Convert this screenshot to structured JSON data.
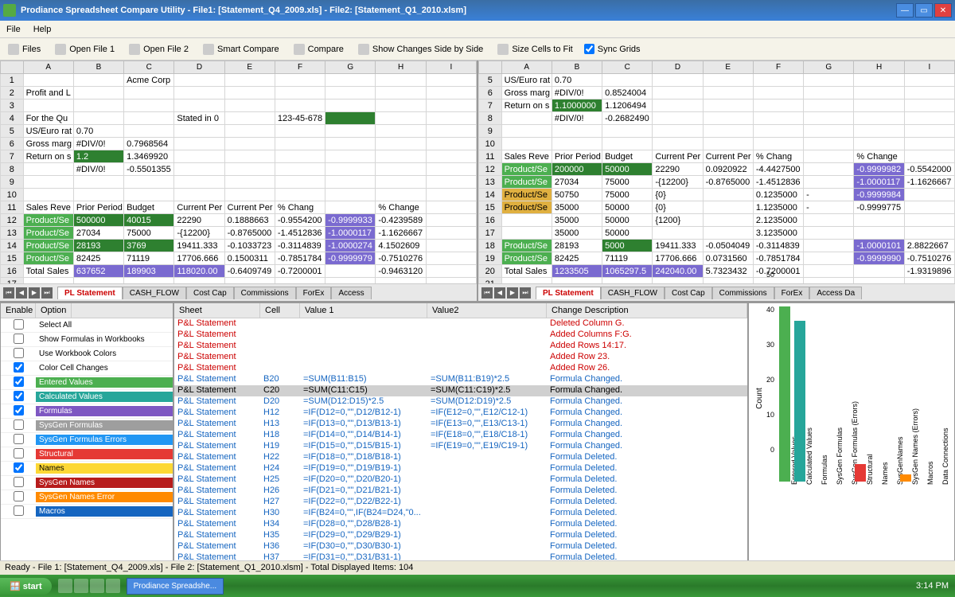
{
  "window": {
    "title": "Prodiance Spreadsheet Compare Utility - File1: [Statement_Q4_2009.xls] - File2: [Statement_Q1_2010.xlsm]"
  },
  "menu": {
    "file": "File",
    "help": "Help"
  },
  "toolbar": {
    "files": "Files",
    "open1": "Open File 1",
    "open2": "Open File 2",
    "smart": "Smart Compare",
    "compare": "Compare",
    "sidebyside": "Show Changes Side by Side",
    "sizecells": "Size Cells to Fit",
    "syncgrids": "Sync Grids"
  },
  "sheet_cols": [
    "",
    "A",
    "B",
    "C",
    "D",
    "E",
    "F",
    "G",
    "H",
    "I"
  ],
  "sheet1": [
    [
      "1",
      "",
      "",
      "Acme Corp",
      "",
      "",
      "",
      "",
      "",
      ""
    ],
    [
      "2",
      "Profit and L",
      "",
      "",
      "",
      "",
      "",
      "",
      "",
      ""
    ],
    [
      "3",
      "",
      "",
      "",
      "",
      "",
      "",
      "",
      "",
      ""
    ],
    [
      "4",
      "For the Qu",
      "",
      "",
      "Stated in 0",
      "",
      "123-45-678",
      "",
      "",
      ""
    ],
    [
      "5",
      "US/Euro rat",
      "0.70",
      "",
      "",
      "",
      "",
      "",
      "",
      ""
    ],
    [
      "6",
      "Gross marg",
      "#DIV/0!",
      "0.7968564",
      "",
      "",
      "",
      "",
      "",
      ""
    ],
    [
      "7",
      "Return on s",
      "1.2",
      "1.3469920",
      "",
      "",
      "",
      "",
      "",
      ""
    ],
    [
      "8",
      "",
      "#DIV/0!",
      "-0.5501355",
      "",
      "",
      "",
      "",
      "",
      ""
    ],
    [
      "9",
      "",
      "",
      "",
      "",
      "",
      "",
      "",
      "",
      ""
    ],
    [
      "10",
      "",
      "",
      "",
      "",
      "",
      "",
      "",
      "",
      ""
    ],
    [
      "11",
      "Sales Reve",
      "Prior Period",
      "Budget",
      "Current Per",
      "Current Per",
      "% Chang",
      "",
      "% Change",
      ""
    ],
    [
      "12",
      "Product/Se",
      "500000",
      "40015",
      "22290",
      "0.1888663",
      "-0.9554200",
      "-0.9999933",
      "-0.4239589",
      ""
    ],
    [
      "13",
      "Product/Se",
      "27034",
      "75000",
      "-{12200}",
      "-0.8765000",
      "-1.4512836",
      "-1.0000117",
      "-1.1626667",
      ""
    ],
    [
      "14",
      "Product/Se",
      "28193",
      "3769",
      "19411.333",
      "-0.1033723",
      "-0.3114839",
      "-1.0000274",
      "4.1502609",
      ""
    ],
    [
      "15",
      "Product/Se",
      "82425",
      "71119",
      "17706.666",
      "0.1500311",
      "-0.7851784",
      "-0.9999979",
      "-0.7510276",
      ""
    ],
    [
      "16",
      "Total Sales",
      "637652",
      "189903",
      "118020.00",
      "-0.6409749",
      "-0.7200001",
      "",
      "-0.9463120",
      ""
    ],
    [
      "17",
      "",
      "",
      "",
      "",
      "",
      "",
      "",
      "",
      ""
    ]
  ],
  "sheet1_hl": {
    "4": {
      "7": "g-dgreen"
    },
    "7": {
      "2": "g-dgreen"
    },
    "12": {
      "1": "g-green",
      "2": "g-dgreen",
      "3": "g-dgreen",
      "7": "g-purple"
    },
    "13": {
      "1": "g-green",
      "7": "g-purple"
    },
    "14": {
      "1": "g-green",
      "2": "g-dgreen",
      "3": "g-dgreen",
      "7": "g-purple"
    },
    "15": {
      "1": "g-green",
      "7": "g-purple"
    },
    "16": {
      "2": "g-purple",
      "3": "g-purple",
      "4": "g-purple"
    }
  },
  "sheet2": [
    [
      "5",
      "US/Euro rat",
      "0.70",
      "",
      "",
      "",
      "",
      "",
      "",
      ""
    ],
    [
      "6",
      "Gross marg",
      "#DIV/0!",
      "0.8524004",
      "",
      "",
      "",
      "",
      "",
      ""
    ],
    [
      "7",
      "Return on s",
      "1.1000000",
      "1.1206494",
      "",
      "",
      "",
      "",
      "",
      ""
    ],
    [
      "8",
      "",
      "#DIV/0!",
      "-0.2682490",
      "",
      "",
      "",
      "",
      "",
      ""
    ],
    [
      "9",
      "",
      "",
      "",
      "",
      "",
      "",
      "",
      "",
      ""
    ],
    [
      "10",
      "",
      "",
      "",
      "",
      "",
      "",
      "",
      "",
      ""
    ],
    [
      "11",
      "Sales Reve",
      "Prior Period",
      "Budget",
      "Current Per",
      "Current Per",
      "% Chang",
      "",
      "% Change",
      ""
    ],
    [
      "12",
      "Product/Se",
      "200000",
      "50000",
      "22290",
      "0.0920922",
      "-4.4427500",
      "",
      "-0.9999982",
      "-0.5542000"
    ],
    [
      "13",
      "Product/Se",
      "27034",
      "75000",
      "-{12200}",
      "-0.8765000",
      "-1.4512836",
      "",
      "-1.0000117",
      "-1.1626667"
    ],
    [
      "14",
      "Product/Se",
      "50750",
      "75000",
      "{0}",
      "",
      "0.1235000",
      "-",
      "-0.9999984",
      ""
    ],
    [
      "15",
      "Product/Se",
      "35000",
      "50000",
      "{0}",
      "",
      "1.1235000",
      "-",
      "-0.9999775",
      ""
    ],
    [
      "16",
      "",
      "35000",
      "50000",
      "{1200}",
      "",
      "2.1235000",
      "",
      "",
      ""
    ],
    [
      "17",
      "",
      "35000",
      "50000",
      "",
      "",
      "3.1235000",
      "",
      "",
      ""
    ],
    [
      "18",
      "Product/Se",
      "28193",
      "5000",
      "19411.333",
      "-0.0504049",
      "-0.3114839",
      "",
      "-1.0000101",
      "2.8822667"
    ],
    [
      "19",
      "Product/Se",
      "82425",
      "71119",
      "17706.666",
      "0.0731560",
      "-0.7851784",
      "",
      "-0.9999990",
      "-0.7510276"
    ],
    [
      "20",
      "Total Sales",
      "1233505",
      "1065297.5",
      "242040.00",
      "5.7323432",
      "-0.7200001",
      "",
      "",
      "-1.9319896"
    ],
    [
      "21",
      "",
      "",
      "",
      "",
      "",
      "",
      "",
      "",
      ""
    ]
  ],
  "sheet2_hl": {
    "7": {
      "2": "g-dgreen"
    },
    "12": {
      "1": "g-green",
      "2": "g-dgreen",
      "3": "g-dgreen",
      "8": "g-purple"
    },
    "13": {
      "1": "g-green",
      "8": "g-purple"
    },
    "14": {
      "1": "g-orange",
      "8": "g-purple"
    },
    "15": {
      "1": "g-orange"
    },
    "18": {
      "1": "g-green",
      "3": "g-dgreen",
      "8": "g-purple"
    },
    "19": {
      "1": "g-green",
      "8": "g-purple"
    },
    "20": {
      "2": "g-purple",
      "3": "g-purple",
      "4": "g-purple"
    }
  },
  "sheet_tabs": [
    "PL Statement",
    "CASH_FLOW",
    "Cost Cap",
    "Commissions",
    "ForEx",
    "Access"
  ],
  "sheet_tabs2": [
    "PL Statement",
    "CASH_FLOW",
    "Cost Cap",
    "Commissions",
    "ForEx",
    "Access Da"
  ],
  "opt_header": {
    "enable": "Enable",
    "option": "Option"
  },
  "options": [
    {
      "label": "Select All",
      "checked": false,
      "cls": ""
    },
    {
      "label": "Show Formulas in Workbooks",
      "checked": false,
      "cls": ""
    },
    {
      "label": "Use Workbook Colors",
      "checked": false,
      "cls": ""
    },
    {
      "label": "Color Cell Changes",
      "checked": true,
      "cls": ""
    },
    {
      "label": "Entered Values",
      "checked": true,
      "cls": "c-green"
    },
    {
      "label": "Calculated Values",
      "checked": true,
      "cls": "c-teal"
    },
    {
      "label": "Formulas",
      "checked": true,
      "cls": "c-purple"
    },
    {
      "label": "SysGen Formulas",
      "checked": false,
      "cls": "c-gray"
    },
    {
      "label": "SysGen Formulas Errors",
      "checked": false,
      "cls": "c-blue"
    },
    {
      "label": "Structural",
      "checked": false,
      "cls": "c-red"
    },
    {
      "label": "Names",
      "checked": true,
      "cls": "c-yellow"
    },
    {
      "label": "SysGen Names",
      "checked": false,
      "cls": "c-dred"
    },
    {
      "label": "SysGen Names Error",
      "checked": false,
      "cls": "c-orange"
    },
    {
      "label": "Macros",
      "checked": false,
      "cls": "c-dblue"
    }
  ],
  "diff_header": {
    "sheet": "Sheet",
    "cell": "Cell",
    "v1": "Value 1",
    "v2": "Value2",
    "desc": "Change Description"
  },
  "diffs": [
    {
      "cls": "red",
      "sheet": "P&L Statement",
      "cell": "",
      "v1": "",
      "v2": "",
      "desc": "Deleted Column G."
    },
    {
      "cls": "red",
      "sheet": "P&L Statement",
      "cell": "",
      "v1": "",
      "v2": "",
      "desc": "Added Columns F:G."
    },
    {
      "cls": "red",
      "sheet": "P&L Statement",
      "cell": "",
      "v1": "",
      "v2": "",
      "desc": "Added Rows 14:17."
    },
    {
      "cls": "red",
      "sheet": "P&L Statement",
      "cell": "",
      "v1": "",
      "v2": "",
      "desc": "Added Row 23."
    },
    {
      "cls": "red",
      "sheet": "P&L Statement",
      "cell": "",
      "v1": "",
      "v2": "",
      "desc": "Added Row 26."
    },
    {
      "cls": "blue",
      "sheet": "P&L Statement",
      "cell": "B20",
      "v1": "=SUM(B11:B15)",
      "v2": "=SUM(B11:B19)*2.5",
      "desc": "Formula Changed."
    },
    {
      "cls": "sel",
      "sheet": "P&L Statement",
      "cell": "C20",
      "v1": "=SUM(C11:C15)",
      "v2": "=SUM(C11:C19)*2.5",
      "desc": "Formula Changed."
    },
    {
      "cls": "blue",
      "sheet": "P&L Statement",
      "cell": "D20",
      "v1": "=SUM(D12:D15)*2.5",
      "v2": "=SUM(D12:D19)*2.5",
      "desc": "Formula Changed."
    },
    {
      "cls": "blue",
      "sheet": "P&L Statement",
      "cell": "H12",
      "v1": "=IF(D12=0,\"\",D12/B12-1)",
      "v2": "=IF(E12=0,\"\",E12/C12-1)",
      "desc": "Formula Changed."
    },
    {
      "cls": "blue",
      "sheet": "P&L Statement",
      "cell": "H13",
      "v1": "=IF(D13=0,\"\",D13/B13-1)",
      "v2": "=IF(E13=0,\"\",E13/C13-1)",
      "desc": "Formula Changed."
    },
    {
      "cls": "blue",
      "sheet": "P&L Statement",
      "cell": "H18",
      "v1": "=IF(D14=0,\"\",D14/B14-1)",
      "v2": "=IF(E18=0,\"\",E18/C18-1)",
      "desc": "Formula Changed."
    },
    {
      "cls": "blue",
      "sheet": "P&L Statement",
      "cell": "H19",
      "v1": "=IF(D15=0,\"\",D15/B15-1)",
      "v2": "=IF(E19=0,\"\",E19/C19-1)",
      "desc": "Formula Changed."
    },
    {
      "cls": "blue",
      "sheet": "P&L Statement",
      "cell": "H22",
      "v1": "=IF(D18=0,\"\",D18/B18-1)",
      "v2": "",
      "desc": "Formula Deleted."
    },
    {
      "cls": "blue",
      "sheet": "P&L Statement",
      "cell": "H24",
      "v1": "=IF(D19=0,\"\",D19/B19-1)",
      "v2": "",
      "desc": "Formula Deleted."
    },
    {
      "cls": "blue",
      "sheet": "P&L Statement",
      "cell": "H25",
      "v1": "=IF(D20=0,\"\",D20/B20-1)",
      "v2": "",
      "desc": "Formula Deleted."
    },
    {
      "cls": "blue",
      "sheet": "P&L Statement",
      "cell": "H26",
      "v1": "=IF(D21=0,\"\",D21/B21-1)",
      "v2": "",
      "desc": "Formula Deleted."
    },
    {
      "cls": "blue",
      "sheet": "P&L Statement",
      "cell": "H27",
      "v1": "=IF(D22=0,\"\",D22/B22-1)",
      "v2": "",
      "desc": "Formula Deleted."
    },
    {
      "cls": "blue",
      "sheet": "P&L Statement",
      "cell": "H30",
      "v1": "=IF(B24=0,\"\",IF(B24=D24,\"0...",
      "v2": "",
      "desc": "Formula Deleted."
    },
    {
      "cls": "blue",
      "sheet": "P&L Statement",
      "cell": "H34",
      "v1": "=IF(D28=0,\"\",D28/B28-1)",
      "v2": "",
      "desc": "Formula Deleted."
    },
    {
      "cls": "blue",
      "sheet": "P&L Statement",
      "cell": "H35",
      "v1": "=IF(D29=0,\"\",D29/B29-1)",
      "v2": "",
      "desc": "Formula Deleted."
    },
    {
      "cls": "blue",
      "sheet": "P&L Statement",
      "cell": "H36",
      "v1": "=IF(D30=0,\"\",D30/B30-1)",
      "v2": "",
      "desc": "Formula Deleted."
    },
    {
      "cls": "blue",
      "sheet": "P&L Statement",
      "cell": "H37",
      "v1": "=IF(D31=0,\"\",D31/B31-1)",
      "v2": "",
      "desc": "Formula Deleted."
    }
  ],
  "chart_data": {
    "type": "bar",
    "title": "",
    "ylabel": "Count",
    "ylim": [
      0,
      50
    ],
    "categories": [
      "Entered Values",
      "Calculated Values",
      "Formulas",
      "SysGen Formulas",
      "SysGen Formulas (Errors)",
      "Structural",
      "Names",
      "SysGenNames",
      "SysGen Names (Errors)",
      "Macros",
      "Data Connections"
    ],
    "values": [
      50,
      46,
      0,
      0,
      0,
      5,
      0,
      0,
      2,
      0,
      0
    ],
    "colors": [
      "#4caf50",
      "#26a69a",
      "#7e57c2",
      "#9e9e9e",
      "#2196f3",
      "#e53935",
      "#fdd835",
      "#b71c1c",
      "#ff8a00",
      "#1565c0",
      "#888"
    ]
  },
  "status": "Ready - File 1: [Statement_Q4_2009.xls] - File 2: [Statement_Q1_2010.xlsm] - Total Displayed Items: 104",
  "taskbar": {
    "start": "start",
    "app": "Prodiance Spreadshe...",
    "time": "3:14 PM"
  }
}
